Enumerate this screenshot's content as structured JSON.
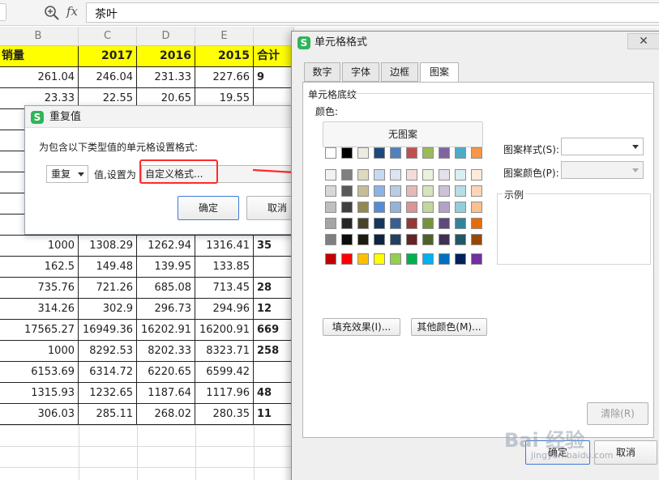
{
  "formula_bar": {
    "zoom_icon": "zoom-icon",
    "fx_label": "fx",
    "content": "茶叶"
  },
  "sheet": {
    "columns": [
      "B",
      "C",
      "D",
      "E"
    ],
    "header_row": [
      "销量",
      "2017",
      "2016",
      "2015",
      "合计"
    ],
    "rows": [
      [
        "261.04",
        "246.04",
        "231.33",
        "227.66",
        "9"
      ],
      [
        "23.33",
        "22.55",
        "20.65",
        "19.55",
        ""
      ],
      [
        "",
        "",
        "",
        "",
        ""
      ],
      [
        "",
        "",
        "",
        "",
        ""
      ],
      [
        "",
        "",
        "",
        "",
        ""
      ],
      [
        "",
        "",
        "",
        "",
        ""
      ],
      [
        "",
        "",
        "",
        "",
        ""
      ],
      [
        "",
        "",
        "",
        "",
        ""
      ],
      [
        "1000",
        "1308.29",
        "1262.94",
        "1316.41",
        "35"
      ],
      [
        "162.5",
        "149.48",
        "139.95",
        "133.85",
        ""
      ],
      [
        "735.76",
        "721.26",
        "685.08",
        "713.45",
        "28"
      ],
      [
        "314.26",
        "302.9",
        "296.73",
        "294.96",
        "12"
      ],
      [
        "17565.27",
        "16949.36",
        "16202.91",
        "16200.91",
        "669"
      ],
      [
        "1000",
        "8292.53",
        "8202.33",
        "8323.71",
        "258"
      ],
      [
        "6153.69",
        "6314.72",
        "6220.65",
        "6599.42",
        ""
      ],
      [
        "1315.93",
        "1232.65",
        "1187.64",
        "1117.96",
        "48"
      ],
      [
        "306.03",
        "285.11",
        "268.02",
        "280.35",
        "11"
      ]
    ]
  },
  "duplicate_dialog": {
    "title": "重复值",
    "description": "为包含以下类型值的单元格设置格式:",
    "type_select": "重复",
    "set_label": "值,设置为",
    "format_select": "自定义格式...",
    "ok": "确定",
    "cancel": "取消"
  },
  "format_dialog": {
    "title": "单元格格式",
    "tabs": [
      "数字",
      "字体",
      "边框",
      "图案"
    ],
    "active_tab": "图案",
    "section_title": "单元格底纹",
    "color_label": "颜色:",
    "no_pattern": "无图案",
    "pattern_style_label": "图案样式(S):",
    "pattern_color_label": "图案颜色(P):",
    "sample_label": "示例",
    "fill_effects": "填充效果(I)...",
    "more_colors": "其他颜色(M)...",
    "clear": "清除(R)",
    "ok": "确定",
    "cancel": "取消",
    "close_icon": "close-icon"
  },
  "colors": {
    "row0": [
      "#ffffff",
      "#000000",
      "#eeece1",
      "#1f497d",
      "#4f81bd",
      "#c0504d",
      "#9bbb59",
      "#8064a2",
      "#4bacc6",
      "#f79646"
    ],
    "row1": [
      "#f2f2f2",
      "#7f7f7f",
      "#ddd9c3",
      "#c6d9f0",
      "#dbe5f1",
      "#f2dcdb",
      "#ebf1dd",
      "#e5e0ec",
      "#dbeef3",
      "#fdeada"
    ],
    "row2": [
      "#d8d8d8",
      "#595959",
      "#c4bd97",
      "#8db3e2",
      "#b8cce4",
      "#e5b9b7",
      "#d7e3bc",
      "#ccc1d9",
      "#b7dde8",
      "#fbd5b5"
    ],
    "row3": [
      "#bfbfbf",
      "#3f3f3f",
      "#938953",
      "#548dd4",
      "#95b3d7",
      "#d99694",
      "#c3d69b",
      "#b2a2c7",
      "#92cddc",
      "#fac08f"
    ],
    "row4": [
      "#a5a5a5",
      "#262626",
      "#494429",
      "#17365d",
      "#366092",
      "#953734",
      "#76923c",
      "#5f497a",
      "#31859b",
      "#e36c09"
    ],
    "row5": [
      "#7f7f7f",
      "#0c0c0c",
      "#1d1b10",
      "#0f243e",
      "#244061",
      "#632423",
      "#4f6128",
      "#3f3151",
      "#205867",
      "#974806"
    ],
    "standard": [
      "#c00000",
      "#ff0000",
      "#ffc000",
      "#ffff00",
      "#92d050",
      "#00b050",
      "#00b0f0",
      "#0070c0",
      "#002060",
      "#7030a0"
    ],
    "highlight_red": "#ff2b2b",
    "header_yellow": "#ffff00"
  },
  "watermark": {
    "main": "Bai 经验",
    "sub": "jingyan.baidu.com"
  }
}
